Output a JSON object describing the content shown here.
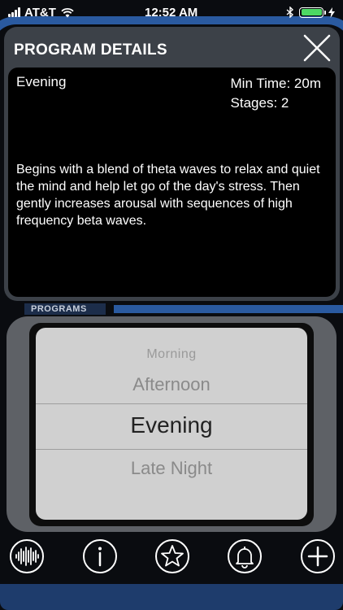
{
  "status_bar": {
    "carrier": "AT&T",
    "time": "12:52 AM"
  },
  "modal": {
    "title": "PROGRAM DETAILS",
    "program_name": "Evening",
    "min_time": "Min Time: 20m",
    "stages": "Stages: 2",
    "description": "Begins with a blend of theta waves to relax and quiet the mind and help let go of the day's stress.  Then gently increases arousal with sequences of high frequency beta waves."
  },
  "programs_section": {
    "label": "PROGRAMS"
  },
  "picker": {
    "items": [
      {
        "label": "Morning"
      },
      {
        "label": "Afternoon"
      },
      {
        "label": "Evening"
      },
      {
        "label": "Late Night"
      }
    ],
    "selected": "Evening"
  },
  "toolbar": {
    "icons": [
      "waveform-icon",
      "info-icon",
      "star-icon",
      "bell-icon",
      "plus-icon"
    ]
  },
  "colors": {
    "accent_blue": "#2a5aa0",
    "battery_green": "#4cd964"
  }
}
